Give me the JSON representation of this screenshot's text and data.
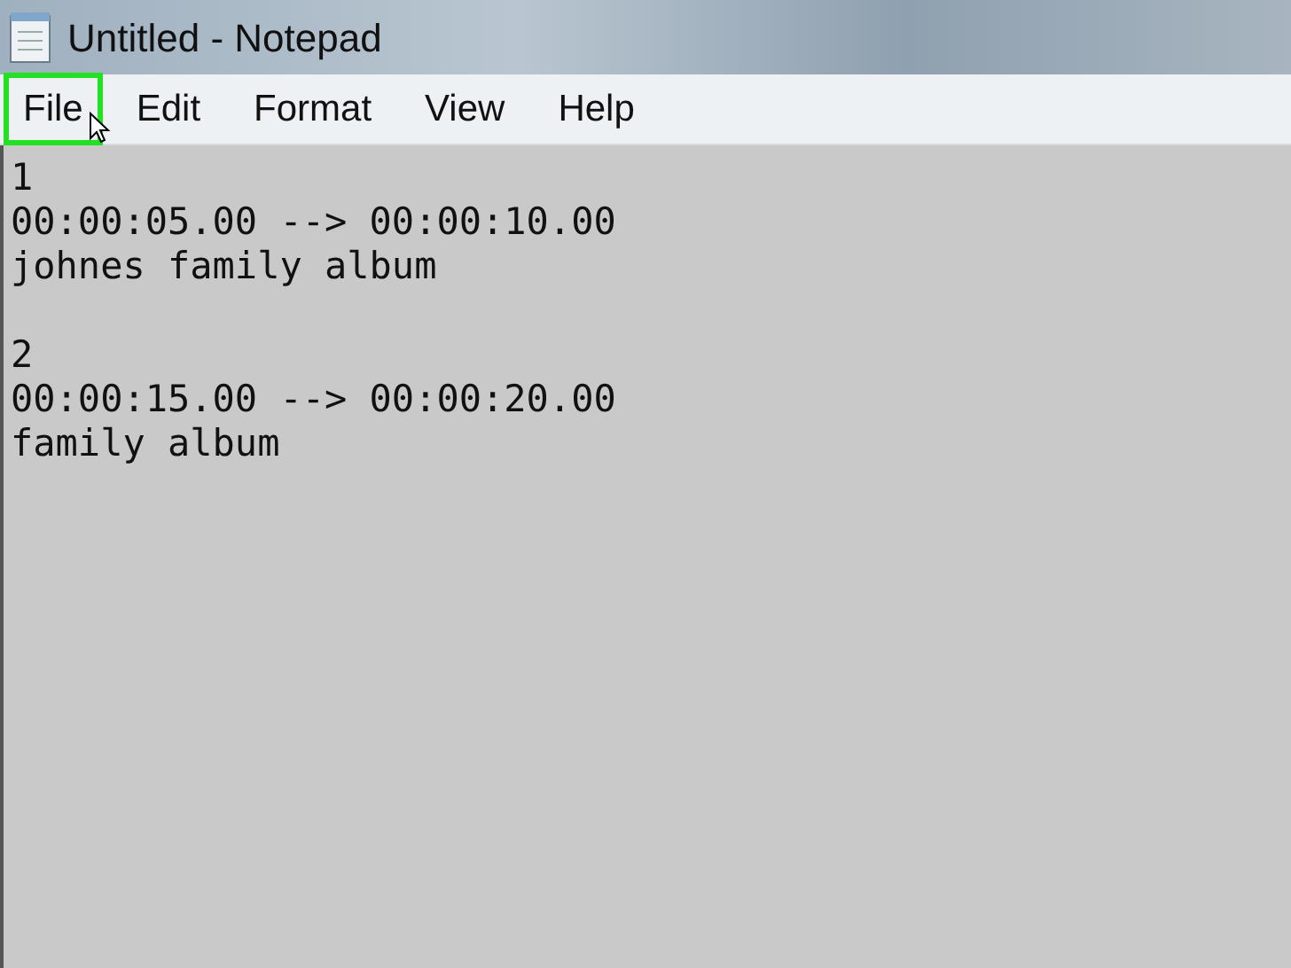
{
  "window": {
    "title": "Untitled - Notepad"
  },
  "menu": [
    {
      "label": "File",
      "highlighted": true
    },
    {
      "label": "Edit",
      "highlighted": false
    },
    {
      "label": "Format",
      "highlighted": false
    },
    {
      "label": "View",
      "highlighted": false
    },
    {
      "label": "Help",
      "highlighted": false
    }
  ],
  "editor": {
    "text": "1\n00:00:05.00 --> 00:00:10.00\njohnes family album\n\n2\n00:00:15.00 --> 00:00:20.00\nfamily album"
  }
}
